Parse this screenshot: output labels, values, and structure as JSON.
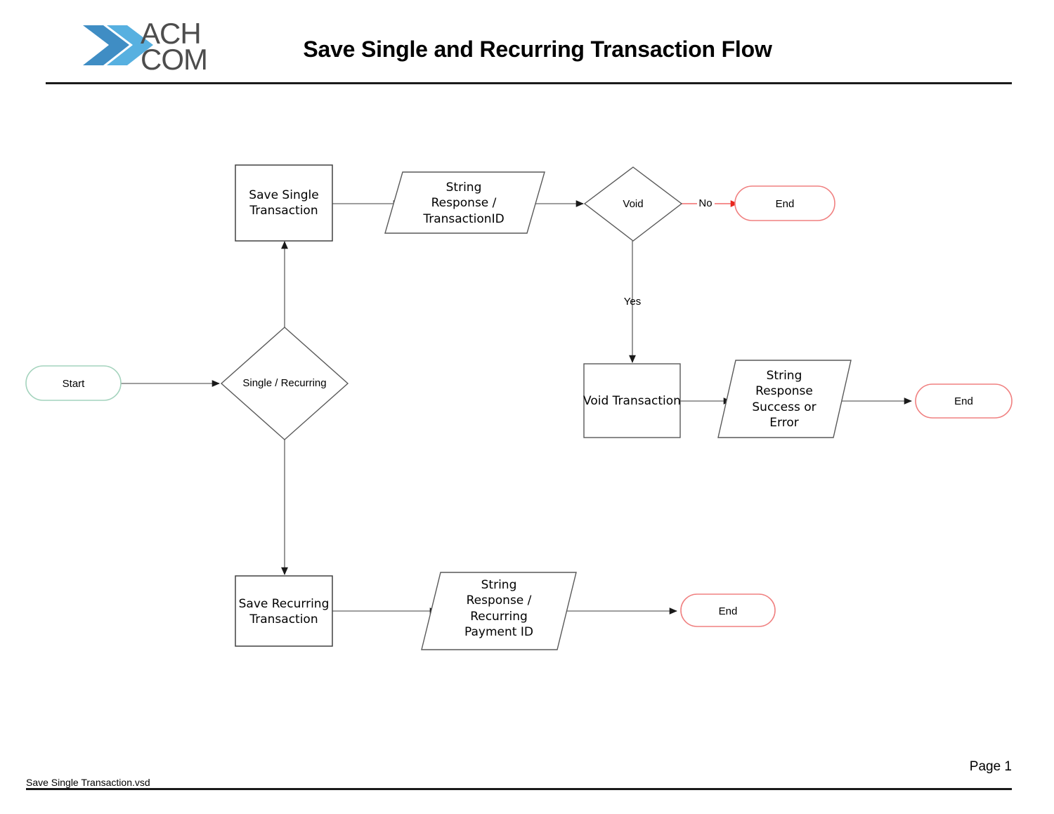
{
  "header": {
    "title": "Save Single and Recurring Transaction Flow",
    "logo_name": "ach-com-logo",
    "logo_text_top": "ACH",
    "logo_text_bottom": "COM"
  },
  "footer": {
    "filename": "Save Single Transaction.vsd",
    "page_number": "Page 1"
  },
  "colors": {
    "start_stroke": "#a4d3bd",
    "end_stroke": "#f08080",
    "no_branch_stroke": "#f26b6b",
    "shape_stroke": "#595959",
    "process_stroke": "#404040",
    "connector_stroke": "#7f7f7f",
    "logo_blue_dark": "#3f8dc4",
    "logo_blue_light": "#5ab4e5",
    "logo_text": "#4d4d4d",
    "rule": "#1a1a1a"
  },
  "nodes": [
    {
      "id": "start",
      "type": "terminator",
      "label": "Start"
    },
    {
      "id": "single_rec",
      "type": "decision",
      "label": "Single / Recurring"
    },
    {
      "id": "save_single",
      "type": "process",
      "label": "Save Single\nTransaction"
    },
    {
      "id": "resp_txnid",
      "type": "io",
      "label": "String\nResponse /\nTransactionID"
    },
    {
      "id": "void",
      "type": "decision",
      "label": "Void"
    },
    {
      "id": "end_no",
      "type": "terminator",
      "label": "End"
    },
    {
      "id": "void_txn",
      "type": "process",
      "label": "Void Transaction"
    },
    {
      "id": "resp_void",
      "type": "io",
      "label": "String\nResponse\nSuccess or\nError"
    },
    {
      "id": "end_void",
      "type": "terminator",
      "label": "End"
    },
    {
      "id": "save_recur",
      "type": "process",
      "label": "Save Recurring\nTransaction"
    },
    {
      "id": "resp_recur",
      "type": "io",
      "label": "String\nResponse /\nRecurring\nPayment ID"
    },
    {
      "id": "end_recur",
      "type": "terminator",
      "label": "End"
    }
  ],
  "edges": [
    {
      "from": "start",
      "to": "single_rec",
      "label": ""
    },
    {
      "from": "single_rec",
      "to": "save_single",
      "label": ""
    },
    {
      "from": "single_rec",
      "to": "save_recur",
      "label": ""
    },
    {
      "from": "save_single",
      "to": "resp_txnid",
      "label": ""
    },
    {
      "from": "resp_txnid",
      "to": "void",
      "label": ""
    },
    {
      "from": "void",
      "to": "end_no",
      "label": "No"
    },
    {
      "from": "void",
      "to": "void_txn",
      "label": "Yes"
    },
    {
      "from": "void_txn",
      "to": "resp_void",
      "label": ""
    },
    {
      "from": "resp_void",
      "to": "end_void",
      "label": ""
    },
    {
      "from": "save_recur",
      "to": "resp_recur",
      "label": ""
    },
    {
      "from": "resp_recur",
      "to": "end_recur",
      "label": ""
    }
  ],
  "edge_labels": {
    "no": "No",
    "yes": "Yes"
  }
}
